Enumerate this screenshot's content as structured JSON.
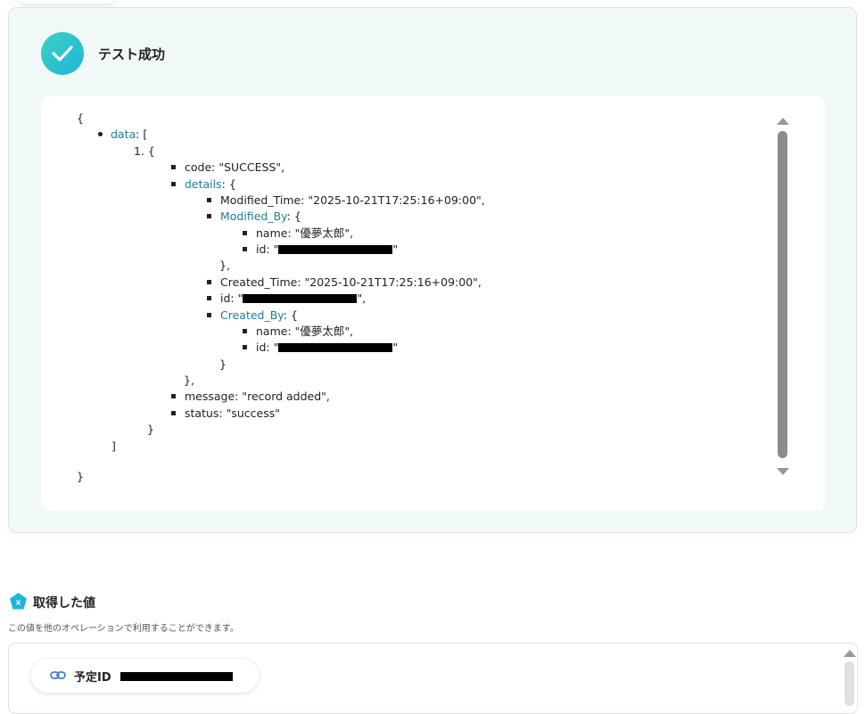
{
  "test_result": {
    "title": "テスト成功",
    "json_lines": [
      {
        "pre": "{"
      },
      {
        "key": "data",
        "post": ": ["
      },
      {
        "pre": "1. {"
      },
      {
        "key": "code",
        "post": ": \"SUCCESS\","
      },
      {
        "key": "details",
        "post": ": {"
      },
      {
        "key": "Modified_Time",
        "post": ": \"2025-10-21T17:25:16+09:00\","
      },
      {
        "key": "Modified_By",
        "post": ": {"
      },
      {
        "key": "name",
        "post": ": \"優夢太郎\","
      },
      {
        "key": "id",
        "post": ": \""
      },
      {
        "pre": "},"
      },
      {
        "key": "Created_Time",
        "post": ": \"2025-10-21T17:25:16+09:00\","
      },
      {
        "key": "id",
        "post": ": \""
      },
      {
        "key": "Created_By",
        "post": ": {"
      },
      {
        "key": "name",
        "post": ": \"優夢太郎\","
      },
      {
        "key": "id",
        "post": ": \""
      },
      {
        "pre": "}"
      },
      {
        "pre": "},"
      },
      {
        "key": "message",
        "post": ": \"record added\","
      },
      {
        "key": "status",
        "post": ": \"success\""
      },
      {
        "pre": "}"
      },
      {
        "pre": "]"
      },
      {
        "pre": "}"
      }
    ],
    "redacted_suffix_1": "\"",
    "redacted_suffix_2": "\",",
    "redacted_suffix_3": "\""
  },
  "acquired_values": {
    "title": "取得した値",
    "description": "この値を他のオペレーションで利用することができます。",
    "chip_label": "予定ID"
  },
  "colors": {
    "accent": "#1fb5d8",
    "link_key": "#1f7d99",
    "card_bg": "#f1f9f8"
  }
}
